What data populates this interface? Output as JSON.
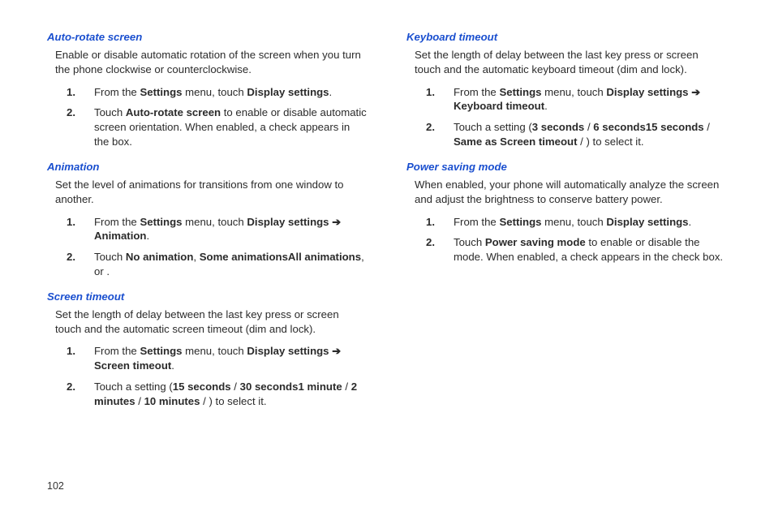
{
  "pageNumber": "102",
  "arrow": "➔",
  "sections": [
    {
      "title": "Auto-rotate screen",
      "desc": "Enable or disable automatic rotation of the screen when you turn the phone clockwise or counterclockwise.",
      "steps": [
        {
          "pre": "From the ",
          "b1": "Settings",
          "mid1": " menu, touch ",
          "b2": "Display settings",
          "post1": "."
        },
        {
          "pre": "Touch ",
          "b1": "Auto-rotate screen",
          "post1": " to enable or disable automatic screen orientation. When enabled, a check appears in the box."
        }
      ]
    },
    {
      "title": "Animation",
      "desc": "Set the level of animations for transitions from one window to another.",
      "steps": [
        {
          "pre": "From the ",
          "b1": "Settings",
          "mid1": " menu, touch ",
          "b2": "Display settings ",
          "arrow": true,
          "b3": " Animation",
          "post1": "."
        },
        {
          "pre": "Touch ",
          "b1": "No animation",
          "mid1": ", ",
          "b2": "Some animations",
          "mid2": ", or ",
          "b3": "All animations",
          "post1": "."
        }
      ]
    },
    {
      "title": "Screen timeout",
      "desc": "Set the length of delay between the last key press or screen touch and the automatic screen timeout (dim and lock).",
      "steps": [
        {
          "pre": "From the ",
          "b1": "Settings",
          "mid1": " menu, touch ",
          "b2": "Display settings ",
          "arrow": true,
          "b3": " Screen timeout",
          "post1": "."
        },
        {
          "pre": "Touch a setting (",
          "b1": "15 seconds",
          "mid1": " / ",
          "b2": "30 seconds",
          "mid2": " / ",
          "b3": "1 minute",
          "mid3": " / ",
          "b4": "2 minutes",
          "mid4": " / ",
          "b5": "10 minutes",
          "post1": ") to select it."
        }
      ]
    },
    {
      "title": "Keyboard timeout",
      "desc": "Set the length of delay between the last key press or screen touch and the automatic keyboard timeout (dim and lock).",
      "steps": [
        {
          "pre": "From the ",
          "b1": "Settings",
          "mid1": " menu, touch ",
          "b2": "Display settings ",
          "arrow": true,
          "b3": " Keyboard timeout",
          "post1": "."
        },
        {
          "pre": "Touch a setting (",
          "b1": "3 seconds",
          "mid1": " / ",
          "b2": "6 seconds",
          "mid2": " / ",
          "b3": "15 seconds",
          "mid3": " / ",
          "b4": "Same as Screen timeout",
          "post1": ") to select it."
        }
      ]
    },
    {
      "title": "Power saving mode",
      "desc": "When enabled, your phone will automatically analyze the screen and adjust the brightness to conserve battery power.",
      "steps": [
        {
          "pre": "From the ",
          "b1": "Settings",
          "mid1": " menu, touch ",
          "b2": "Display settings",
          "post1": "."
        },
        {
          "pre": "Touch ",
          "b1": "Power saving mode",
          "post1": " to enable or disable the mode. When enabled, a check appears in the check box."
        }
      ]
    }
  ]
}
